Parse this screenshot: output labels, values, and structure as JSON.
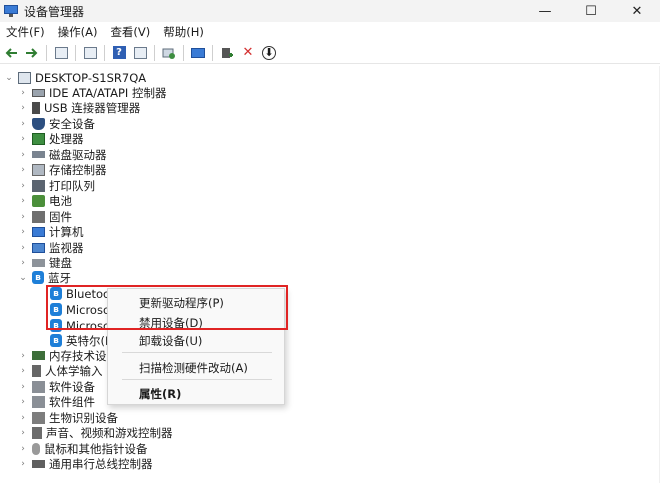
{
  "window": {
    "title": "设备管理器",
    "controls": [
      "—",
      "☐",
      "✕"
    ]
  },
  "menubar": [
    {
      "label": "文件(F)"
    },
    {
      "label": "操作(A)"
    },
    {
      "label": "查看(V)"
    },
    {
      "label": "帮助(H)"
    }
  ],
  "toolbar": {
    "icons": [
      "back-arrow-icon",
      "forward-arrow-icon",
      "properties-icon",
      "show-hidden-icon",
      "help-icon",
      "console-tree-icon",
      "scan-hardware-icon",
      "computer-monitor-icon",
      "add-driver-icon",
      "uninstall-x-icon",
      "update-driver-icon"
    ],
    "help_glyph": "?",
    "uninstall_glyph": "✕",
    "update_glyph": "⬇"
  },
  "tree": {
    "root": "DESKTOP-S1SR7QA",
    "root_chevron": "⌄",
    "categories": [
      {
        "label": "IDE ATA/ATAPI 控制器",
        "chev": "›",
        "icon": "ide-controller-icon"
      },
      {
        "label": "USB 连接器管理器",
        "chev": "›",
        "icon": "usb-icon"
      },
      {
        "label": "安全设备",
        "chev": "›",
        "icon": "shield-icon"
      },
      {
        "label": "处理器",
        "chev": "›",
        "icon": "processor-icon"
      },
      {
        "label": "磁盘驱动器",
        "chev": "›",
        "icon": "disk-drive-icon"
      },
      {
        "label": "存储控制器",
        "chev": "›",
        "icon": "storage-icon"
      },
      {
        "label": "打印队列",
        "chev": "›",
        "icon": "printer-icon"
      },
      {
        "label": "电池",
        "chev": "›",
        "icon": "battery-icon"
      },
      {
        "label": "固件",
        "chev": "›",
        "icon": "firmware-icon"
      },
      {
        "label": "计算机",
        "chev": "›",
        "icon": "computer-icon"
      },
      {
        "label": "监视器",
        "chev": "›",
        "icon": "monitor-icon"
      },
      {
        "label": "键盘",
        "chev": "›",
        "icon": "keyboard-icon"
      },
      {
        "label": "蓝牙",
        "chev": "⌄",
        "icon": "bluetooth-icon"
      }
    ],
    "bluetooth_children": [
      {
        "label": "Bluetoot"
      },
      {
        "label": "Microsof"
      },
      {
        "label": "Microsof"
      },
      {
        "label": "英特尔(F"
      }
    ],
    "bt_glyph": "ʙ",
    "categories_after": [
      {
        "label": "内存技术设",
        "chev": "›",
        "icon": "memory-icon"
      },
      {
        "label": "人体学输入",
        "chev": "›",
        "icon": "human-interface-icon"
      },
      {
        "label": "软件设备",
        "chev": "›",
        "icon": "software-device-icon"
      },
      {
        "label": "软件组件",
        "chev": "›",
        "icon": "software-component-icon"
      },
      {
        "label": "生物识别设备",
        "chev": "›",
        "icon": "biometric-icon"
      },
      {
        "label": "声音、视频和游戏控制器",
        "chev": "›",
        "icon": "sound-icon"
      },
      {
        "label": "鼠标和其他指针设备",
        "chev": "›",
        "icon": "mouse-icon"
      },
      {
        "label": "通用串行总线控制器",
        "chev": "›",
        "icon": "usb-controller-icon"
      }
    ]
  },
  "context_menu": {
    "update_driver": "更新驱动程序(P)",
    "disable_device": "禁用设备(D)",
    "uninstall_device": "卸载设备(U)",
    "scan_hardware": "扫描检测硬件改动(A)",
    "properties": "属性(R)"
  },
  "colors": {
    "highlight_border": "#e02424",
    "bluetooth_blue": "#1e7fd8"
  }
}
